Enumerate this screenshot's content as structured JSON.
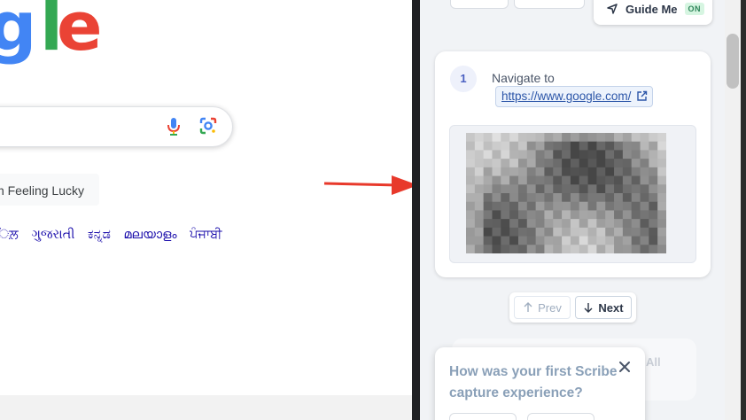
{
  "google": {
    "logo_g": "g",
    "logo_l": "l",
    "logo_e": "e",
    "lucky_label": "n Feeling Lucky",
    "languages": [
      "ਿਲ਼",
      "ગુજરાતી",
      "ಕನ್ನಡ",
      "മലയാളം",
      "ਪੰਜਾਬੀ"
    ]
  },
  "scribe": {
    "guide_label": "Guide Me",
    "guide_badge": "ON",
    "step": {
      "number": "1",
      "title": "Navigate to",
      "link": "https://www.google.com/"
    },
    "pager": {
      "prev_label": "Prev",
      "next_label": "Next"
    },
    "back_card_text": "All",
    "feedback": {
      "question": "How was your first Scribe capture experience?"
    }
  },
  "colors": {
    "google_blue": "#4285f4",
    "google_green": "#34a853",
    "google_red": "#ea4335",
    "link_blue": "#1a0dab",
    "arrow_red": "#e8392b",
    "on_badge_green": "#2f855a"
  },
  "icons": {
    "mic": "mic-icon",
    "lens": "google-lens-icon",
    "arrow": "red-arrow-annotation",
    "guide": "navigation-arrow-icon",
    "external": "external-link-icon",
    "prev": "arrow-up-icon",
    "next": "arrow-down-icon",
    "close": "close-icon"
  }
}
